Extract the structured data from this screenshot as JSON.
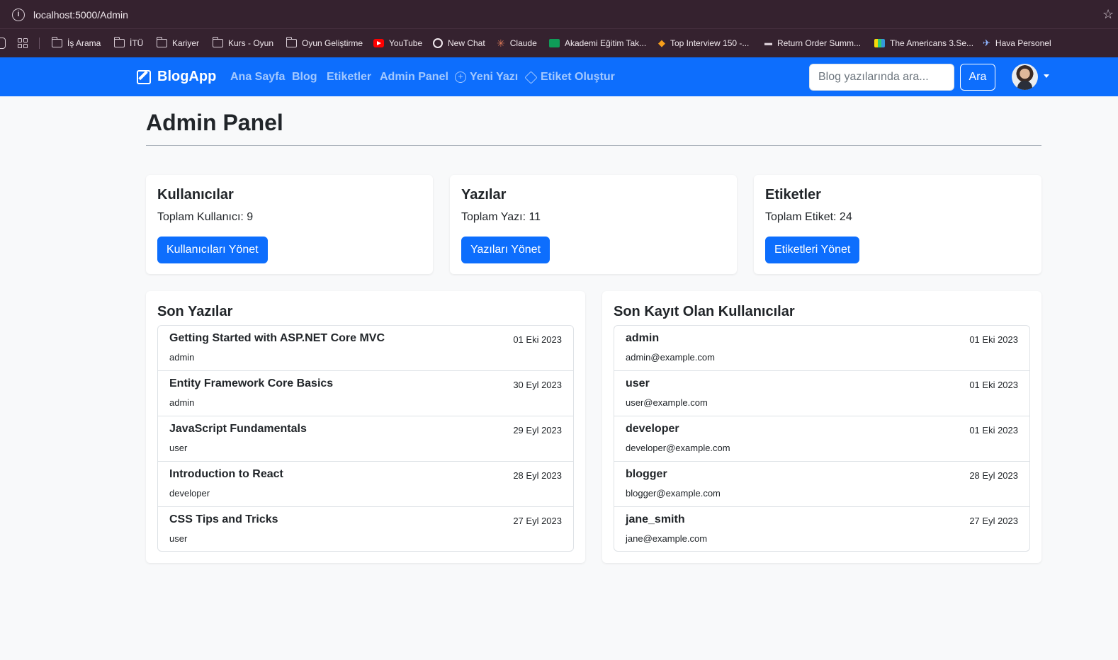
{
  "browser": {
    "url": "localhost:5000/Admin",
    "bookmarks": [
      {
        "label": "İş Arama",
        "icon": "folder-icon"
      },
      {
        "label": "İTÜ",
        "icon": "folder-icon"
      },
      {
        "label": "Kariyer",
        "icon": "folder-icon"
      },
      {
        "label": "Kurs - Oyun",
        "icon": "folder-icon"
      },
      {
        "label": "Oyun Geliştirme",
        "icon": "folder-icon"
      },
      {
        "label": "YouTube",
        "icon": "youtube-icon"
      },
      {
        "label": "New Chat",
        "icon": "chat-icon"
      },
      {
        "label": "Claude",
        "icon": "claude-icon"
      },
      {
        "label": "Akademi Eğitim Tak...",
        "icon": "sheet-icon"
      },
      {
        "label": "Top Interview 150 -...",
        "icon": "leetcode-icon"
      },
      {
        "label": "Return Order Summ...",
        "icon": "page-icon"
      },
      {
        "label": "The Americans 3.Se...",
        "icon": "tv-icon"
      },
      {
        "label": "Hava Personel",
        "icon": "plane-icon"
      }
    ]
  },
  "navbar": {
    "brand": "BlogApp",
    "links": [
      "Ana Sayfa",
      "Blog",
      "Etiketler",
      "Admin Panel",
      "Yeni Yazı",
      "Etiket Oluştur"
    ],
    "search_placeholder": "Blog yazılarında ara...",
    "search_button": "Ara",
    "brand_color": "#0d6efd"
  },
  "page": {
    "title": "Admin Panel",
    "stats": [
      {
        "title": "Kullanıcılar",
        "text": "Toplam Kullanıcı: 9",
        "button": "Kullanıcıları Yönet"
      },
      {
        "title": "Yazılar",
        "text": "Toplam Yazı: 11",
        "button": "Yazıları Yönet"
      },
      {
        "title": "Etiketler",
        "text": "Toplam Etiket: 24",
        "button": "Etiketleri Yönet"
      }
    ],
    "recent_posts": {
      "title": "Son Yazılar",
      "items": [
        {
          "title": "Getting Started with ASP.NET Core MVC",
          "author": "admin",
          "date": "01 Eki 2023"
        },
        {
          "title": "Entity Framework Core Basics",
          "author": "admin",
          "date": "30 Eyl 2023"
        },
        {
          "title": "JavaScript Fundamentals",
          "author": "user",
          "date": "29 Eyl 2023"
        },
        {
          "title": "Introduction to React",
          "author": "developer",
          "date": "28 Eyl 2023"
        },
        {
          "title": "CSS Tips and Tricks",
          "author": "user",
          "date": "27 Eyl 2023"
        }
      ]
    },
    "recent_users": {
      "title": "Son Kayıt Olan Kullanıcılar",
      "items": [
        {
          "name": "admin",
          "email": "admin@example.com",
          "date": "01 Eki 2023"
        },
        {
          "name": "user",
          "email": "user@example.com",
          "date": "01 Eki 2023"
        },
        {
          "name": "developer",
          "email": "developer@example.com",
          "date": "01 Eki 2023"
        },
        {
          "name": "blogger",
          "email": "blogger@example.com",
          "date": "28 Eyl 2023"
        },
        {
          "name": "jane_smith",
          "email": "jane@example.com",
          "date": "27 Eyl 2023"
        }
      ]
    }
  }
}
